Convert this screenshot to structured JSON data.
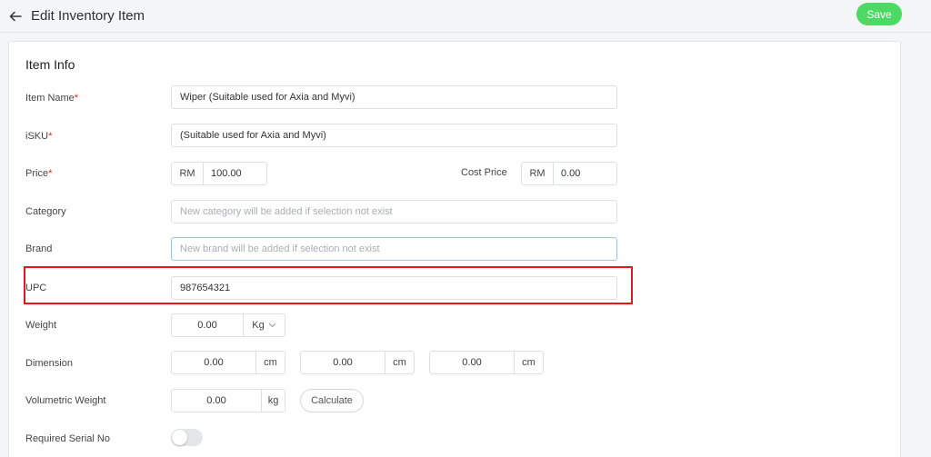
{
  "header": {
    "title": "Edit Inventory Item",
    "save_label": "Save"
  },
  "section": {
    "title": "Item Info"
  },
  "fields": {
    "item_name": {
      "label": "Item Name",
      "required_mark": "*",
      "value": "Wiper (Suitable used for Axia and Myvi)"
    },
    "isku": {
      "label": "iSKU",
      "required_mark": "*",
      "value": "(Suitable used for Axia and Myvi)"
    },
    "price": {
      "label": "Price",
      "required_mark": "*",
      "currency": "RM",
      "value": "100.00"
    },
    "cost_price": {
      "label": "Cost Price",
      "currency": "RM",
      "value": "0.00"
    },
    "category": {
      "label": "Category",
      "placeholder": "New category will be added if selection not exist"
    },
    "brand": {
      "label": "Brand",
      "placeholder": "New brand will be added if selection not exist"
    },
    "upc": {
      "label": "UPC",
      "value": "987654321"
    },
    "weight": {
      "label": "Weight",
      "value": "0.00",
      "unit": "Kg"
    },
    "dimension": {
      "label": "Dimension",
      "length": "0.00",
      "width": "0.00",
      "height": "0.00",
      "unit": "cm"
    },
    "volumetric_weight": {
      "label": "Volumetric Weight",
      "value": "0.00",
      "unit": "kg",
      "calculate_label": "Calculate"
    },
    "serial_no": {
      "label": "Required Serial No",
      "enabled": false
    }
  },
  "colors": {
    "save": "#4cd964",
    "required": "#e02424",
    "highlight": "#e0191e"
  }
}
